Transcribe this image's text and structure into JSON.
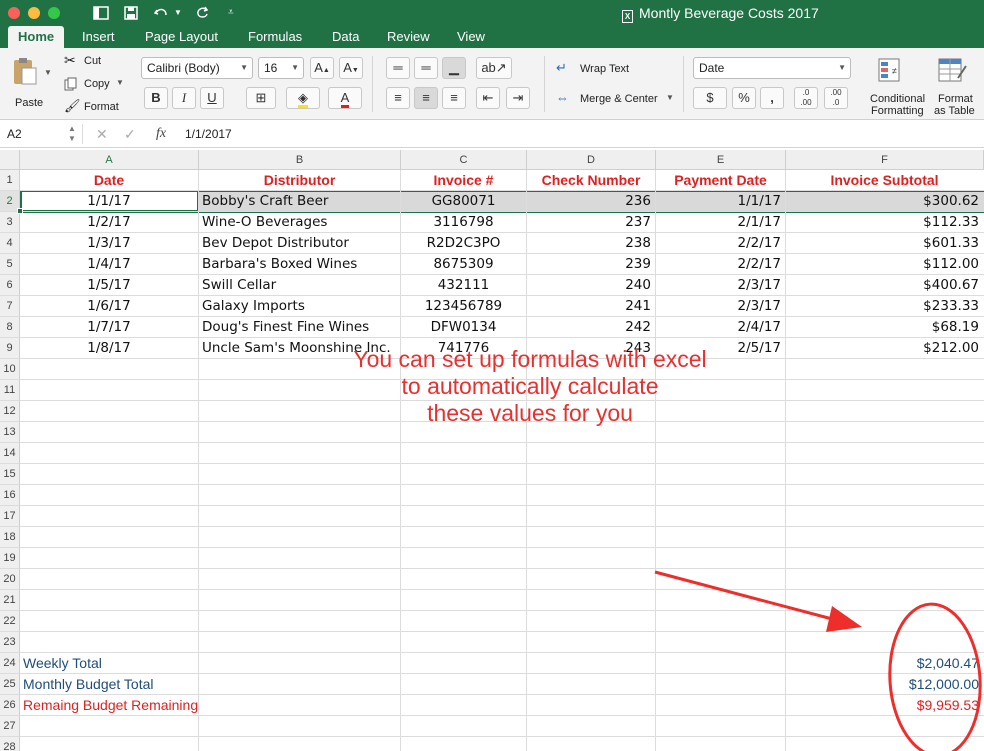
{
  "window": {
    "title": "Montly Beverage Costs 2017",
    "titlebar_color": "#207245"
  },
  "quick_access": [
    "sidebar-toggle-icon",
    "save-icon",
    "undo-icon",
    "redo-icon",
    "customize-icon"
  ],
  "tabs": [
    {
      "label": "Home",
      "active": true
    },
    {
      "label": "Insert"
    },
    {
      "label": "Page Layout"
    },
    {
      "label": "Formulas"
    },
    {
      "label": "Data"
    },
    {
      "label": "Review"
    },
    {
      "label": "View"
    }
  ],
  "ribbon": {
    "paste": "Paste",
    "cut": "Cut",
    "copy": "Copy",
    "format": "Format",
    "font_name": "Calibri (Body)",
    "font_size": "16",
    "wrap_text": "Wrap Text",
    "merge_center": "Merge & Center",
    "number_format": "Date",
    "currency": "$",
    "percent": "%",
    "comma": "⦸",
    "conditional_1": "Conditional",
    "conditional_2": "Formatting",
    "format_table_1": "Format",
    "format_table_2": "as Table",
    "bold": "B",
    "italic": "I",
    "underline": "U"
  },
  "formula_bar": {
    "name_box": "A2",
    "fx": "fx",
    "value": "1/1/2017"
  },
  "columns": [
    "A",
    "B",
    "C",
    "D",
    "E",
    "F"
  ],
  "headers": {
    "date": "Date",
    "distributor": "Distributor",
    "invoice": "Invoice #",
    "check": "Check Number",
    "payment": "Payment Date",
    "subtotal": "Invoice Subtotal"
  },
  "rows": [
    {
      "date": "1/1/17",
      "distributor": "Bobby's Craft Beer",
      "invoice": "GG80071",
      "check": "236",
      "payment": "1/1/17",
      "subtotal": "$300.62"
    },
    {
      "date": "1/2/17",
      "distributor": "Wine-O Beverages",
      "invoice": "3116798",
      "check": "237",
      "payment": "2/1/17",
      "subtotal": "$112.33"
    },
    {
      "date": "1/3/17",
      "distributor": "Bev Depot Distributor",
      "invoice": "R2D2C3PO",
      "check": "238",
      "payment": "2/2/17",
      "subtotal": "$601.33"
    },
    {
      "date": "1/4/17",
      "distributor": "Barbara's Boxed Wines",
      "invoice": "8675309",
      "check": "239",
      "payment": "2/2/17",
      "subtotal": "$112.00"
    },
    {
      "date": "1/5/17",
      "distributor": "Swill Cellar",
      "invoice": "432111",
      "check": "240",
      "payment": "2/3/17",
      "subtotal": "$400.67"
    },
    {
      "date": "1/6/17",
      "distributor": "Galaxy Imports",
      "invoice": "123456789",
      "check": "241",
      "payment": "2/3/17",
      "subtotal": "$233.33"
    },
    {
      "date": "1/7/17",
      "distributor": "Doug's Finest Fine Wines",
      "invoice": "DFW0134",
      "check": "242",
      "payment": "2/4/17",
      "subtotal": "$68.19"
    },
    {
      "date": "1/8/17",
      "distributor": "Uncle Sam's Moonshine Inc.",
      "invoice": "741776",
      "check": "243",
      "payment": "2/5/17",
      "subtotal": "$212.00"
    }
  ],
  "row_numbers": [
    "1",
    "2",
    "3",
    "4",
    "5",
    "6",
    "7",
    "8",
    "9",
    "10",
    "11",
    "12",
    "13",
    "14",
    "15",
    "16",
    "17",
    "18",
    "19",
    "20",
    "21",
    "22",
    "23",
    "24",
    "25",
    "26",
    "27",
    "28"
  ],
  "totals": {
    "weekly_label": "Weekly Total",
    "weekly_value": "$2,040.47",
    "budget_label": "Monthly Budget Total",
    "budget_value": "$12,000.00",
    "remaining_label": "Remaing Budget Remaining",
    "remaining_value": "$9,959.53"
  },
  "annotation": {
    "line1": "You can set up formulas with excel",
    "line2": "to automatically calculate",
    "line3": "these values for you",
    "color": "#e8312f"
  }
}
